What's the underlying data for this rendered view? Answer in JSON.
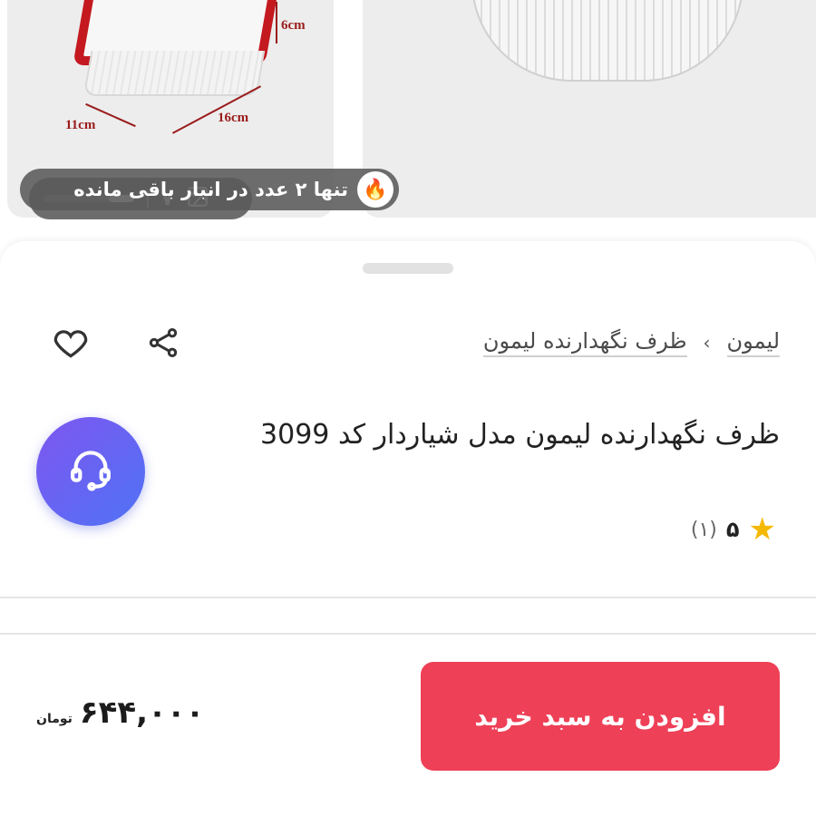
{
  "gallery": {
    "left_card": {
      "image_count": "۷",
      "dims": {
        "height": "6cm",
        "width": "11cm",
        "length": "16cm"
      }
    },
    "right_card": {
      "stock_notice": "تنها ۲ عدد در انبار باقی مانده"
    }
  },
  "breadcrumb": {
    "items": [
      "لیمون",
      "ظرف نگهدارنده لیمون"
    ],
    "separator": "›"
  },
  "product": {
    "title": "ظرف نگهدارنده لیمون مدل شیاردار کد 3099",
    "rating_value": "۵",
    "rating_count": "(۱)"
  },
  "purchase": {
    "price": "۶۴۴,۰۰۰",
    "currency": "تومان",
    "add_to_cart_label": "افزودن به سبد خرید"
  },
  "colors": {
    "accent": "#ee4057",
    "support_gradient_start": "#7f56f0",
    "support_gradient_end": "#4f73f5",
    "star": "#f5b800"
  },
  "icons": [
    "image-icon",
    "fire-icon",
    "heart-icon",
    "share-icon",
    "headset-icon",
    "star-icon"
  ]
}
